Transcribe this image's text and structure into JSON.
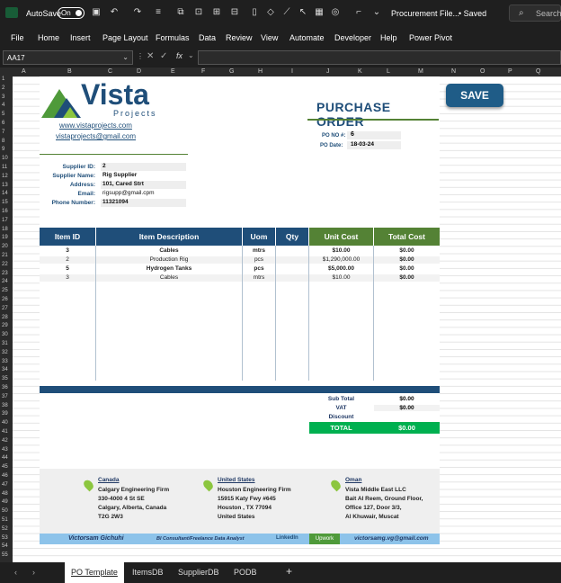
{
  "titlebar": {
    "autosave_label": "AutoSave",
    "autosave_state": "On",
    "file_title": "Procurement File...",
    "save_status": "• Saved",
    "search_placeholder": "Search"
  },
  "menu": [
    "File",
    "Home",
    "Insert",
    "Page Layout",
    "Formulas",
    "Data",
    "Review",
    "View",
    "Automate",
    "Developer",
    "Help",
    "Power Pivot"
  ],
  "formula_bar": {
    "name_box": "AA17",
    "fx": "fx",
    "formula": ""
  },
  "columns": [
    "A",
    "B",
    "C",
    "D",
    "E",
    "F",
    "G",
    "H",
    "I",
    "J",
    "K",
    "L",
    "M",
    "N",
    "O",
    "P",
    "Q"
  ],
  "rows": [
    "1",
    "2",
    "3",
    "4",
    "5",
    "6",
    "7",
    "8",
    "9",
    "10",
    "11",
    "12",
    "13",
    "14",
    "15",
    "16",
    "17",
    "18",
    "19",
    "20",
    "21",
    "22",
    "23",
    "24",
    "25",
    "26",
    "27",
    "28",
    "29",
    "30",
    "31",
    "32",
    "33",
    "34",
    "35",
    "36",
    "37",
    "38",
    "39",
    "40",
    "41",
    "42",
    "43",
    "44",
    "45",
    "46",
    "47",
    "48",
    "49",
    "50",
    "51",
    "52",
    "53",
    "54",
    "55"
  ],
  "logo": {
    "name": "Vista",
    "sub": "Projects"
  },
  "links": {
    "website": "www.vistaprojects.com",
    "email": "vistaprojects@gmail.com"
  },
  "po": {
    "heading": "PURCHASE ORDER",
    "po_no_label": "PO NO #:",
    "po_no": "6",
    "po_date_label": "PO Date:",
    "po_date": "18-03-24"
  },
  "save_button": "SAVE",
  "supplier": [
    {
      "label": "Supplier ID:",
      "value": "2"
    },
    {
      "label": "Supplier Name:",
      "value": "Rig Supplier"
    },
    {
      "label": "Address:",
      "value": "101, Cared Strt"
    },
    {
      "label": "Email:",
      "value": "rigsupp@gmail.cpm"
    },
    {
      "label": "Phone Number:",
      "value": "11321094"
    }
  ],
  "table": {
    "headers": [
      "Item ID",
      "Item Description",
      "Uom",
      "Qty",
      "Unit Cost",
      "Total Cost"
    ],
    "rows": [
      {
        "id": "3",
        "desc": "Cables",
        "uom": "mtrs",
        "qty": "",
        "unit": "$10.00",
        "total": "$0.00",
        "bold": true
      },
      {
        "id": "2",
        "desc": "Production Rig",
        "uom": "pcs",
        "qty": "",
        "unit": "$1,290,000.00",
        "total": "$0.00",
        "bold": false
      },
      {
        "id": "5",
        "desc": "Hydrogen Tanks",
        "uom": "pcs",
        "qty": "",
        "unit": "$5,000.00",
        "total": "$0.00",
        "bold": true
      },
      {
        "id": "3",
        "desc": "Cables",
        "uom": "mtrs",
        "qty": "",
        "unit": "$10.00",
        "total": "$0.00",
        "bold": false
      }
    ]
  },
  "totals": [
    {
      "label": "Sub Total",
      "value": "$0.00"
    },
    {
      "label": "VAT",
      "value": "$0.00"
    },
    {
      "label": "Discount",
      "value": ""
    }
  ],
  "grand_total": {
    "label": "TOTAL",
    "value": "$0.00"
  },
  "offices": [
    {
      "country": "Canada",
      "lines": [
        "Calgary Engineering Firm",
        "330-4000 4 St SE",
        "Calgary, Alberta, Canada",
        "T2G 2W3"
      ]
    },
    {
      "country": "United States",
      "lines": [
        "Houston Engineering Firm",
        "15915 Katy Fwy #645",
        "Houston , TX 77094",
        "United States"
      ]
    },
    {
      "country": "Oman",
      "lines": [
        "Vista Middle East LLC",
        "Bait Al Reem, Ground Floor,",
        "Office 127, Door 3/3,",
        "Al Khuwair, Muscat"
      ]
    }
  ],
  "footer": {
    "name": "Victorsam Gichuhi",
    "role": "BI Consultant/Freelance Data Analyst",
    "linkedin": "LinkedIn",
    "upwork": "Upwork",
    "email": "victorsamg.vg@gmail.com"
  },
  "sheet_tabs": [
    "PO Template",
    "ItemsDB",
    "SupplierDB",
    "PODB"
  ],
  "active_tab": "PO Template",
  "colors": {
    "navy": "#1f4e79",
    "green": "#548235",
    "total_green": "#00b050",
    "footer_blue": "#8dc3ea",
    "save_blue": "#1f5c87"
  }
}
